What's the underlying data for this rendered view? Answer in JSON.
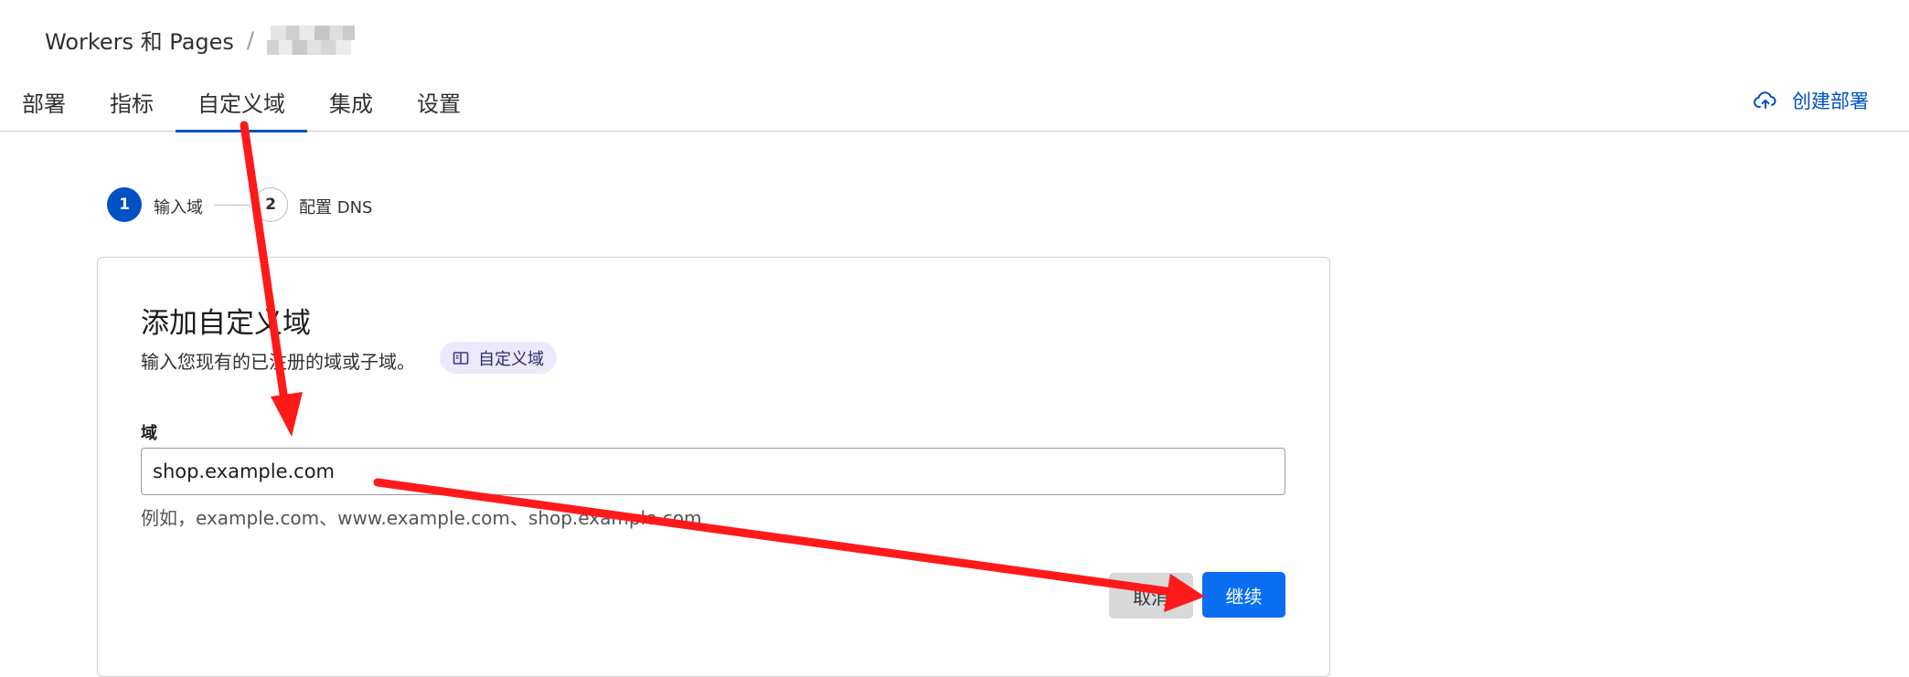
{
  "breadcrumb": {
    "root": "Workers 和 Pages",
    "separator": "/"
  },
  "tabs": [
    {
      "label": "部署"
    },
    {
      "label": "指标"
    },
    {
      "label": "自定义域",
      "active": true
    },
    {
      "label": "集成"
    },
    {
      "label": "设置"
    }
  ],
  "header": {
    "create_deploy_label": "创建部署",
    "create_deploy_icon": "cloud-upload-icon"
  },
  "stepper": {
    "step1_number": "1",
    "step1_label": "输入域",
    "step2_number": "2",
    "step2_label": "配置 DNS"
  },
  "card": {
    "title": "添加自定义域",
    "description": "输入您现有的已注册的域或子域。",
    "doc_link_label": "自定义域",
    "doc_link_icon": "book-icon",
    "field_label": "域",
    "input_value": "shop.example.com",
    "hint": "例如，example.com、www.example.com、shop.example.com",
    "cancel_label": "取消",
    "continue_label": "继续"
  },
  "colors": {
    "accent": "#0051c3",
    "primary_button": "#0a6ef0",
    "annotation": "#ff1a1a",
    "pill_bg": "#ece9fb"
  }
}
